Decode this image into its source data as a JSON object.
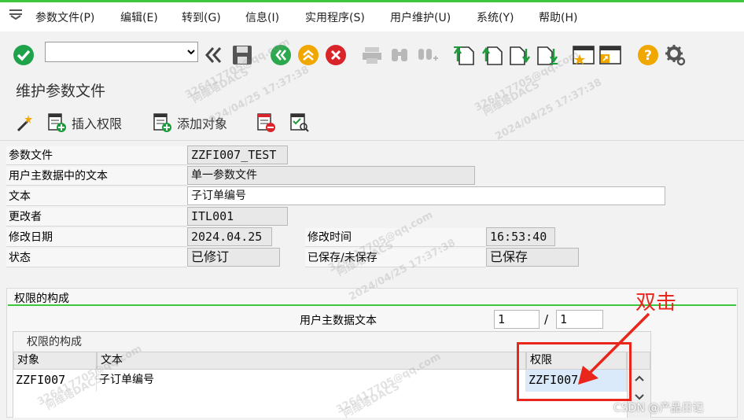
{
  "menu": {
    "items": [
      {
        "label": "参数文件(P)"
      },
      {
        "label": "编辑(E)"
      },
      {
        "label": "转到(G)"
      },
      {
        "label": "信息(I)"
      },
      {
        "label": "实用程序(S)"
      },
      {
        "label": "用户维护(U)"
      },
      {
        "label": "系统(Y)"
      },
      {
        "label": "帮助(H)"
      }
    ]
  },
  "toolbar": {
    "command_field_value": "",
    "icons": [
      "enter-icon",
      "back-nav-icon",
      "save-icon",
      "back-icon",
      "exit-icon",
      "cancel-icon",
      "print-icon",
      "find-icon",
      "find-next-icon",
      "first-page-icon",
      "previous-page-icon",
      "next-page-icon",
      "last-page-icon",
      "new-session-icon",
      "shortcut-icon",
      "help-icon",
      "settings-icon"
    ]
  },
  "page_title": "维护参数文件",
  "app_toolbar": {
    "insert_auth_label": "插入权限",
    "add_object_label": "添加对象"
  },
  "form": {
    "profile_label": "参数文件",
    "profile_value": "ZZFI007_TEST",
    "master_text_label": "用户主数据中的文本",
    "master_text_value": "单一参数文件",
    "text_label": "文本",
    "text_value": "子订单编号",
    "changed_by_label": "更改者",
    "changed_by_value": "ITL001",
    "changed_date_label": "修改日期",
    "changed_date_value": "2024.04.25",
    "changed_time_label": "修改时间",
    "changed_time_value": "16:53:40",
    "status_label": "状态",
    "status_value": "已修订",
    "saved_label": "已保存/未保存",
    "saved_value": "已保存"
  },
  "composition": {
    "section_title": "权限的构成",
    "master_text_label": "用户主数据文本",
    "page_current": "1",
    "page_sep": "/",
    "page_total": "1",
    "table_title": "权限的构成",
    "columns": [
      "对象",
      "文本",
      "权限"
    ],
    "rows": [
      {
        "object": "ZZFI007",
        "text": "子订单编号",
        "auth": "ZZFI007"
      }
    ]
  },
  "annotation": {
    "label": "双击",
    "color": "#e8261c"
  },
  "watermark": {
    "lines": [
      "326417705@qq.com",
      "阿维塔DACS",
      "2024/04/25 17:37:38"
    ],
    "footer": "CSDN @产品日记"
  },
  "colors": {
    "accent_green": "#3ec63e",
    "highlight": "#e8261c"
  }
}
